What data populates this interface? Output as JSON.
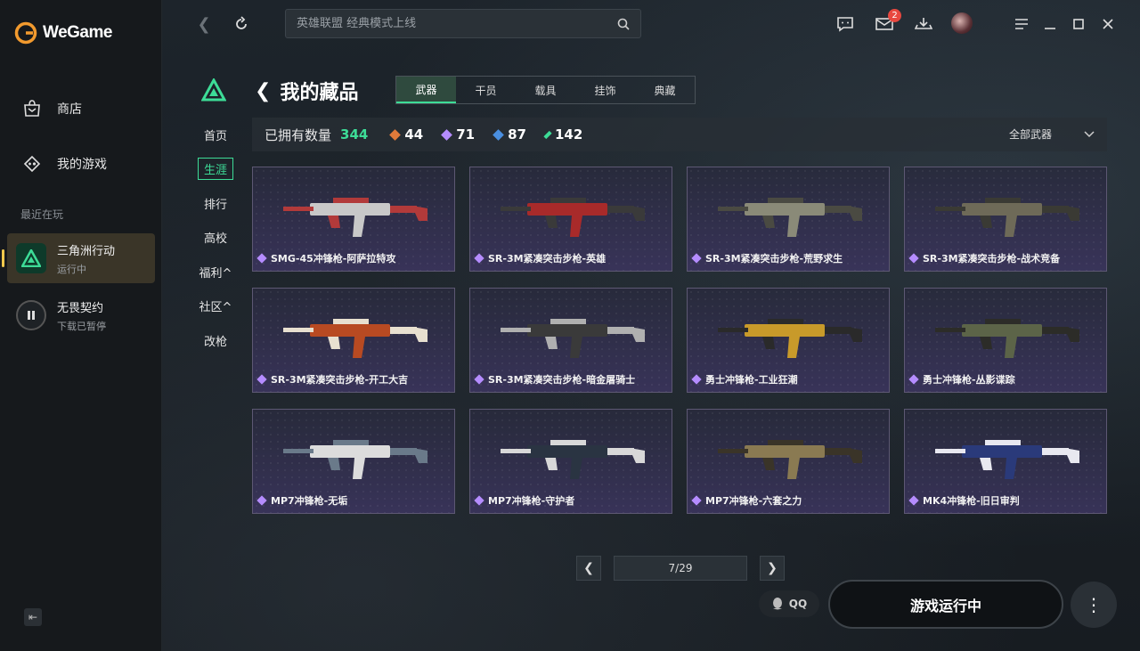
{
  "app": {
    "name": "WeGame"
  },
  "sidebar": {
    "nav": [
      {
        "label": "商店"
      },
      {
        "label": "我的游戏"
      }
    ],
    "recent_title": "最近在玩",
    "recent": [
      {
        "name": "三角洲行动",
        "status": "运行中"
      },
      {
        "name": "无畏契约",
        "status": "下载已暂停"
      }
    ]
  },
  "topbar": {
    "search_placeholder": "英雄联盟 经典模式上线",
    "mail_badge": "2"
  },
  "subnav": [
    {
      "label": "首页"
    },
    {
      "label": "生涯"
    },
    {
      "label": "排行"
    },
    {
      "label": "高校"
    },
    {
      "label": "福利^"
    },
    {
      "label": "社区^"
    },
    {
      "label": "改枪"
    }
  ],
  "page": {
    "title": "我的藏品",
    "tabs": [
      {
        "label": "武器"
      },
      {
        "label": "干员"
      },
      {
        "label": "载具"
      },
      {
        "label": "挂饰"
      },
      {
        "label": "典藏"
      }
    ]
  },
  "stats": {
    "label": "已拥有数量",
    "total": "344",
    "items": [
      {
        "value": "44",
        "color": "#e07a3a"
      },
      {
        "value": "71",
        "color": "#b58cff"
      },
      {
        "value": "87",
        "color": "#4a8fe0"
      },
      {
        "value": "142",
        "color": "#3ddc97"
      }
    ],
    "filter_label": "全部武器"
  },
  "weapons": [
    {
      "name": "SMG-45冲锋枪-阿萨拉特攻",
      "body": "#c8c8c8",
      "accent": "#b23a3a"
    },
    {
      "name": "SR-3M紧凑突击步枪-英雄",
      "body": "#a82a2a",
      "accent": "#3a3a3a"
    },
    {
      "name": "SR-3M紧凑突击步枪-荒野求生",
      "body": "#8a8a78",
      "accent": "#4a4a42"
    },
    {
      "name": "SR-3M紧凑突击步枪-战术竞备",
      "body": "#6e6a58",
      "accent": "#3a3a34"
    },
    {
      "name": "SR-3M紧凑突击步枪-开工大吉",
      "body": "#b84a22",
      "accent": "#e8e0d0"
    },
    {
      "name": "SR-3M紧凑突击步枪-暗金屠骑士",
      "body": "#3a3a3a",
      "accent": "#b0b0b0"
    },
    {
      "name": "勇士冲锋枪-工业狂潮",
      "body": "#c89a2a",
      "accent": "#2a2a2a"
    },
    {
      "name": "勇士冲锋枪-丛影谍踪",
      "body": "#5c6448",
      "accent": "#2c2c28"
    },
    {
      "name": "MP7冲锋枪-无垢",
      "body": "#dcdcdc",
      "accent": "#6a7a8a"
    },
    {
      "name": "MP7冲锋枪-守护者",
      "body": "#2a3442",
      "accent": "#d8d8d8"
    },
    {
      "name": "MP7冲锋枪-六套之力",
      "body": "#8a7a52",
      "accent": "#3a3428"
    },
    {
      "name": "MK4冲锋枪-旧日审判",
      "body": "#2a3a7a",
      "accent": "#e8e8f0"
    }
  ],
  "pager": {
    "text": "7/29"
  },
  "actions": {
    "qq": "QQ",
    "play": "游戏运行中"
  }
}
